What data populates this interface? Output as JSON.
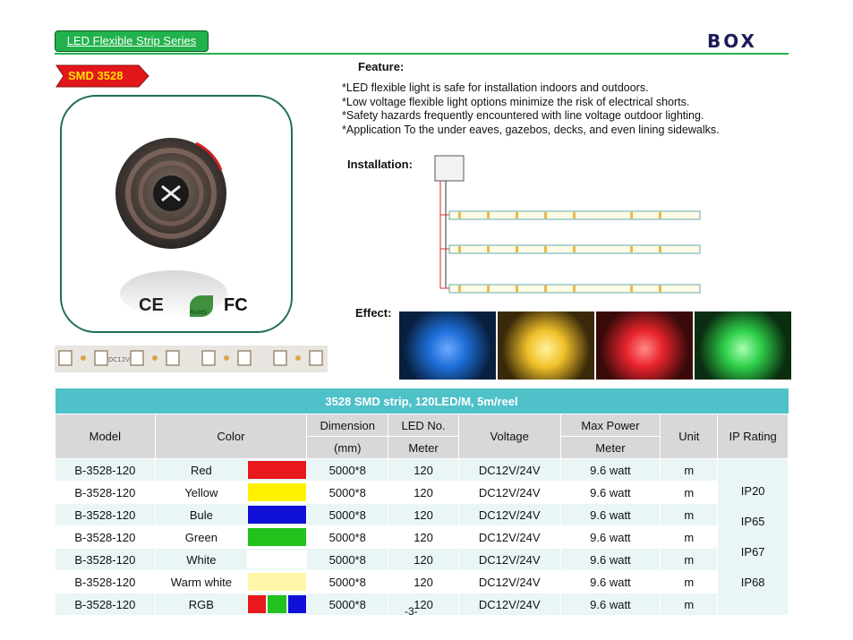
{
  "header": {
    "series_label": "LED Flexible Strip Series",
    "logo": "BOX"
  },
  "product": {
    "tag": "SMD 3528",
    "cert_ce": "CE",
    "cert_rohs": "RoHS",
    "cert_fc": "FC"
  },
  "feature": {
    "title": "Feature:",
    "lines": [
      "*LED flexible light is safe for installation indoors and outdoors.",
      "*Low voltage flexible light options minimize the risk of electrical shorts.",
      "*Safety hazards frequently encountered with line voltage outdoor lighting.",
      "*Application To the under eaves, gazebos, decks, and even lining sidewalks."
    ]
  },
  "installation": {
    "title": "Installation:"
  },
  "effect": {
    "title": "Effect:",
    "colors": [
      "#1e6fd9",
      "#f2c12a",
      "#e8242c",
      "#2fcf4a"
    ]
  },
  "strip_label": "DC12V",
  "table": {
    "title": "3528 SMD strip, 120LED/M, 5m/reel",
    "headers": {
      "model": "Model",
      "color": "Color",
      "dimension": "Dimension",
      "dimension_unit": "(mm)",
      "led_no": "LED No.",
      "led_unit": "Meter",
      "voltage": "Voltage",
      "max_power": "Max Power",
      "power_unit": "Meter",
      "unit": "Unit",
      "ip": "IP Rating"
    },
    "rows": [
      {
        "model": "B-3528-120",
        "color": "Red",
        "swatch": [
          "#e8181c"
        ],
        "dimension": "5000*8",
        "led": "120",
        "voltage": "DC12V/24V",
        "power": "9.6 watt",
        "unit": "m"
      },
      {
        "model": "B-3528-120",
        "color": "Yellow",
        "swatch": [
          "#fff200"
        ],
        "dimension": "5000*8",
        "led": "120",
        "voltage": "DC12V/24V",
        "power": "9.6 watt",
        "unit": "m"
      },
      {
        "model": "B-3528-120",
        "color": "Bule",
        "swatch": [
          "#1010d8"
        ],
        "dimension": "5000*8",
        "led": "120",
        "voltage": "DC12V/24V",
        "power": "9.6 watt",
        "unit": "m"
      },
      {
        "model": "B-3528-120",
        "color": "Green",
        "swatch": [
          "#22c21c"
        ],
        "dimension": "5000*8",
        "led": "120",
        "voltage": "DC12V/24V",
        "power": "9.6 watt",
        "unit": "m"
      },
      {
        "model": "B-3528-120",
        "color": "White",
        "swatch": [
          "#ffffff"
        ],
        "dimension": "5000*8",
        "led": "120",
        "voltage": "DC12V/24V",
        "power": "9.6 watt",
        "unit": "m"
      },
      {
        "model": "B-3528-120",
        "color": "Warm white",
        "swatch": [
          "#fff6a8"
        ],
        "dimension": "5000*8",
        "led": "120",
        "voltage": "DC12V/24V",
        "power": "9.6 watt",
        "unit": "m"
      },
      {
        "model": "B-3528-120",
        "color": "RGB",
        "swatch": [
          "#e8181c",
          "#22c21c",
          "#1010d8"
        ],
        "dimension": "5000*8",
        "led": "120",
        "voltage": "DC12V/24V",
        "power": "9.6 watt",
        "unit": "m"
      }
    ],
    "ip_ratings": [
      "IP20",
      "IP65",
      "IP67",
      "IP68"
    ]
  },
  "page_number": "-3-"
}
